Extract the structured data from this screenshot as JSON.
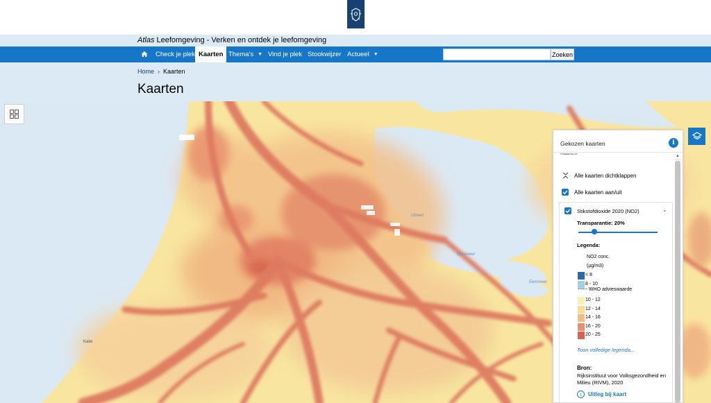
{
  "site": {
    "title_italic": "Atlas",
    "title_rest": " Leefomgeving - Verken en ontdek je leefomgeving"
  },
  "nav": {
    "items": [
      {
        "label": "Check je plek"
      },
      {
        "label": "Kaarten"
      },
      {
        "label": "Thema's"
      },
      {
        "label": "Vind je plek"
      },
      {
        "label": "Stookwijzer"
      },
      {
        "label": "Actueel"
      }
    ],
    "search_placeholder": "",
    "search_button": "Zoeken"
  },
  "breadcrumb": {
    "home": "Home",
    "separator": "›",
    "current": "Kaarten"
  },
  "page": {
    "title": "Kaarten"
  },
  "map": {
    "labels": [
      {
        "text": "IJmeer"
      },
      {
        "text": "Gooimeer"
      },
      {
        "text": "Eemmeer"
      },
      {
        "text": "Katw"
      }
    ]
  },
  "panel": {
    "title": "Gekozen kaarten",
    "clipped_header": "Kaarten",
    "collapse_all": "Alle kaarten dichtklappen",
    "toggle_all": "Alle kaarten aan/uit",
    "layer": {
      "name": "Stikstofdioxide 2020 (NO2)",
      "transparency_label": "Transparantie: 20%",
      "transparency": 20,
      "legend_title": "Legenda:",
      "unit_line1": "NO2 conc.",
      "unit_line2": "(µg/m3)",
      "legend": [
        {
          "label": "< 8",
          "color": "#2e6aa7"
        },
        {
          "label": "8 - 10",
          "color": "#a6cfe3"
        },
        {
          "label": "10 - 12",
          "color": "#fbefb3"
        },
        {
          "label": "12 - 14",
          "color": "#f9dd93"
        },
        {
          "label": "14 - 16",
          "color": "#f1bd85"
        },
        {
          "label": "16 - 20",
          "color": "#e99070"
        },
        {
          "label": "20 - 25",
          "color": "#d8644f"
        }
      ],
      "who_line": "------ WHO advieswaarde",
      "full_legend_link": "Toon volledige legenda...",
      "source_title": "Bron:",
      "source_text": "Rijksinstituut voor Volksgezondheid en Milieu (RIVM), 2020",
      "explain_link": "Uitleg bij kaart"
    }
  },
  "colors": {
    "nav_blue": "#1677c9",
    "header_light": "#dbeaf5",
    "logo_blue": "#154273",
    "map_base": "#f8e6a0",
    "map_high": "#e48a6a",
    "water": "#dbe9f4"
  }
}
